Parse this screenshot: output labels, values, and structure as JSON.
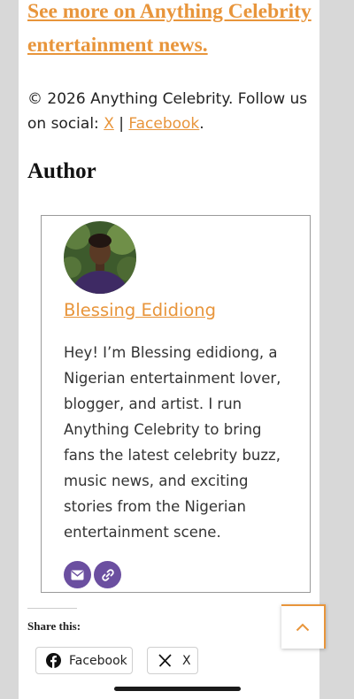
{
  "promo": {
    "see_more": "See more on Anything Celebrity entertainment news."
  },
  "footer": {
    "copyright_prefix": "© 2026 Anything Celebrity. Follow us on social: ",
    "link_x": "X",
    "separator": " | ",
    "link_facebook": "Facebook",
    "suffix": "."
  },
  "author": {
    "heading": "Author",
    "name": "Blessing Edidiong",
    "bio": "Hey! I’m Blessing edidiong, a Nigerian entertainment lover, blogger, and artist. I run Anything Celebrity to bring fans the latest celebrity buzz, music news, and exciting stories from the Nigerian entertainment scene.",
    "social_icons": [
      "email-icon",
      "link-icon"
    ]
  },
  "share": {
    "title": "Share this:",
    "buttons": [
      {
        "label": "Facebook",
        "icon": "facebook-icon"
      },
      {
        "label": "X",
        "icon": "x-icon"
      }
    ]
  },
  "colors": {
    "accent": "#e8953b",
    "social_bg": "#6b4fa0",
    "page_bg": "#d8d8d8"
  }
}
